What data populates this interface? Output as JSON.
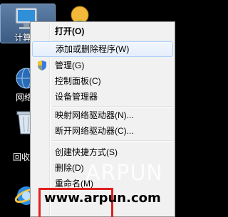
{
  "desktop": {
    "computer_label": "计算机",
    "network_label": "网络",
    "recycle_label": "回收站"
  },
  "context_menu": {
    "items": [
      {
        "label": "打开(O)",
        "bold": true
      },
      {
        "label": "添加或删除程序(W)",
        "highlighted": true
      },
      {
        "label": "管理(G)",
        "icon": "uac-shield-icon"
      },
      {
        "label": "控制面板(C)"
      },
      {
        "label": "设备管理器"
      },
      {
        "label": "映射网络驱动器(N)..."
      },
      {
        "label": "断开网络驱动器(C)..."
      },
      {
        "label": "创建快捷方式(S)"
      },
      {
        "label": "删除(D)"
      },
      {
        "label": "重命名(M)"
      }
    ]
  },
  "watermark": {
    "brand": "ARPUN",
    "url": "www.arpun.com"
  }
}
